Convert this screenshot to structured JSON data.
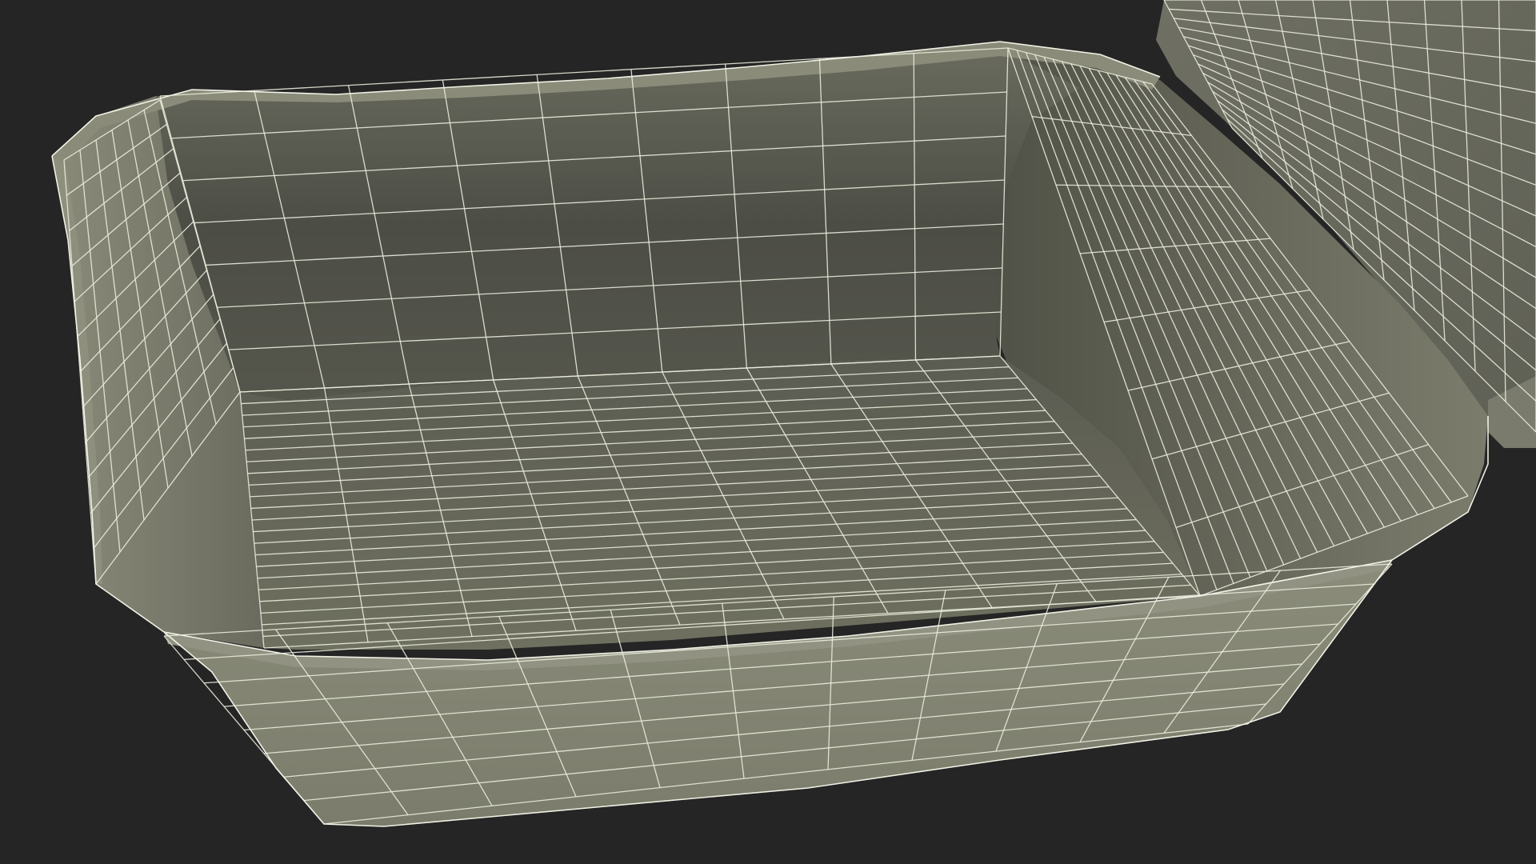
{
  "scene": {
    "subject": "wireframe-render",
    "colors": {
      "background": "#252525",
      "floor_top": "#5a5b50",
      "floor_bottom": "#70715f",
      "wall_back": "#4f5047",
      "wall_left": "#76776a",
      "wall_right": "#676859",
      "outer_front": "#888977",
      "rim": "#7f806f",
      "lid": "#6c6d60",
      "wire": "#e9ebdc"
    }
  }
}
